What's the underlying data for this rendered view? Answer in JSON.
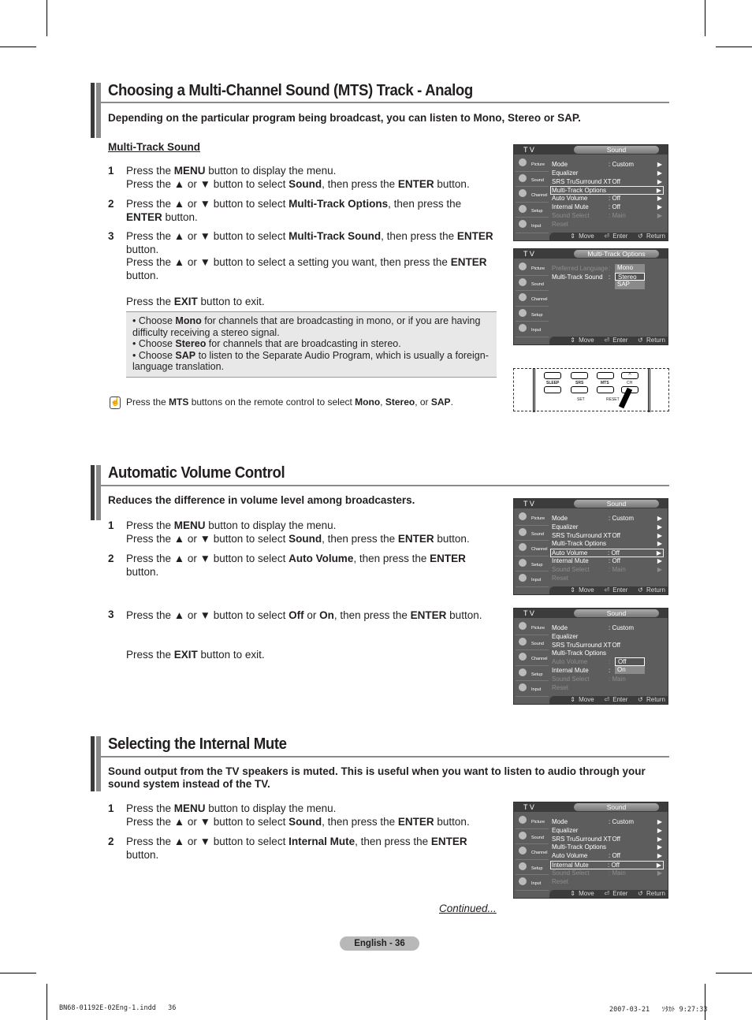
{
  "section1": {
    "title": "Choosing a Multi-Channel Sound (MTS) Track - Analog",
    "lead": "Depending on the particular program being broadcast, you can listen to Mono, Stereo or SAP.",
    "subhead": "Multi-Track Sound",
    "steps": [
      {
        "n": "1",
        "html": "Press the <b>MENU</b> button to display the menu.<br>Press the ▲ or ▼ button to select <b>Sound</b>, then press the <b>ENTER</b> button."
      },
      {
        "n": "2",
        "html": "Press the ▲ or ▼ button to select <b>Multi-Track Options</b>, then press the <b>ENTER</b> button."
      },
      {
        "n": "3",
        "html": "Press the ▲ or ▼ button to select <b>Multi-Track Sound</b>, then press the <b>ENTER</b> button.<br>Press the ▲ or ▼ button to select a setting you want, then press the <b>ENTER</b> button.<br><br>Press the <b>EXIT</b> button to exit."
      }
    ],
    "notes": [
      "• Choose <b>Mono</b> for channels that are broadcasting in mono, or if you are having difficulty receiving a stereo signal.",
      "• Choose <b>Stereo</b> for channels that are broadcasting in stereo.",
      "• Choose <b>SAP</b> to listen to the Separate Audio Program, which is usually a foreign-language translation."
    ],
    "tip": "Press the <b>MTS</b> buttons on the remote control to select <b>Mono</b>, <b>Stereo</b>, or <b>SAP</b>."
  },
  "section2": {
    "title": "Automatic Volume Control",
    "lead": "Reduces the difference in volume level among broadcasters.",
    "steps": [
      {
        "n": "1",
        "html": "Press the <b>MENU</b> button to display the menu.<br>Press the ▲ or ▼ button to select <b>Sound</b>, then press the <b>ENTER</b> button."
      },
      {
        "n": "2",
        "html": "Press the ▲ or ▼ button to select <b>Auto Volume</b>, then press the <b>ENTER</b> button."
      },
      {
        "n": "3",
        "html": "Press the ▲ or ▼ button to select <b>Off</b> or <b>On</b>, then press the <b>ENTER</b> button.<br><br>Press the <b>EXIT</b> button to exit."
      }
    ]
  },
  "section3": {
    "title": "Selecting the Internal Mute",
    "lead": "Sound output from the TV speakers is muted. This is useful when you want to listen to audio through your sound system instead of the TV.",
    "steps": [
      {
        "n": "1",
        "html": "Press the <b>MENU</b> button to display the menu.<br>Press the ▲ or ▼ button to select <b>Sound</b>, then press the <b>ENTER</b> button."
      },
      {
        "n": "2",
        "html": "Press the ▲ or ▼ button to select <b>Internal Mute</b>, then press the <b>ENTER</b> button."
      }
    ],
    "continued": "Continued..."
  },
  "menu_common": {
    "tv": "T V",
    "sidebar": [
      "Picture",
      "Sound",
      "Channel",
      "Setup",
      "Input"
    ],
    "footer": "⇕ Move   ⏎ Enter   ↺ Return"
  },
  "menus": [
    {
      "title": "Sound",
      "rows": [
        [
          "Mode",
          ": Custom",
          "▶",
          ""
        ],
        [
          "Equalizer",
          "",
          "▶",
          ""
        ],
        [
          "SRS TruSurround XT",
          ": Off",
          "▶",
          ""
        ],
        [
          "Multi-Track Options",
          "",
          "▶",
          "sel"
        ],
        [
          "Auto Volume",
          ": Off",
          "▶",
          ""
        ],
        [
          "Internal Mute",
          ": Off",
          "▶",
          ""
        ],
        [
          "Sound Select",
          ": Main",
          "▶",
          "dim"
        ],
        [
          "Reset",
          "",
          "",
          "dim"
        ]
      ]
    },
    {
      "title": "Multi-Track Options",
      "rows": [
        [
          "Preferred Language",
          ":",
          "",
          "dim"
        ],
        [
          "Multi-Track Sound",
          ":",
          "",
          ""
        ]
      ],
      "dropdown": {
        "row": 0,
        "options": [
          "Mono",
          "Stereo",
          "SAP"
        ],
        "selected": 1
      }
    },
    {
      "title": "Sound",
      "rows": [
        [
          "Mode",
          ": Custom",
          "▶",
          ""
        ],
        [
          "Equalizer",
          "",
          "▶",
          ""
        ],
        [
          "SRS TruSurround XT",
          ": Off",
          "▶",
          ""
        ],
        [
          "Multi-Track Options",
          "",
          "▶",
          ""
        ],
        [
          "Auto Volume",
          ": Off",
          "▶",
          "sel"
        ],
        [
          "Internal Mute",
          ": Off",
          "▶",
          ""
        ],
        [
          "Sound Select",
          ": Main",
          "▶",
          "dim"
        ],
        [
          "Reset",
          "",
          "",
          "dim"
        ]
      ]
    },
    {
      "title": "Sound",
      "rows": [
        [
          "Mode",
          ": Custom",
          "",
          ""
        ],
        [
          "Equalizer",
          "",
          "",
          ""
        ],
        [
          "SRS TruSurround XT",
          ": Off",
          "",
          ""
        ],
        [
          "Multi-Track Options",
          "",
          "",
          ""
        ],
        [
          "Auto Volume",
          ":",
          "",
          "dim"
        ],
        [
          "Internal Mute",
          ":",
          "",
          ""
        ],
        [
          "Sound Select",
          ": Main",
          "",
          "dim"
        ],
        [
          "Reset",
          "",
          "",
          "dim"
        ]
      ],
      "dropdown": {
        "row": 4,
        "options": [
          "Off",
          "On"
        ],
        "selected": 0
      }
    },
    {
      "title": "Sound",
      "rows": [
        [
          "Mode",
          ": Custom",
          "▶",
          ""
        ],
        [
          "Equalizer",
          "",
          "▶",
          ""
        ],
        [
          "SRS TruSurround XT",
          ": Off",
          "▶",
          ""
        ],
        [
          "Multi-Track Options",
          "",
          "▶",
          ""
        ],
        [
          "Auto Volume",
          ": Off",
          "▶",
          ""
        ],
        [
          "Internal Mute",
          ": Off",
          "▶",
          "sel"
        ],
        [
          "Sound Select",
          ": Main",
          "▶",
          "dim"
        ],
        [
          "Reset",
          "",
          "",
          "dim"
        ]
      ]
    }
  ],
  "remote": {
    "buttons": [
      "SLEEP",
      "SRS",
      "MTS",
      "CH"
    ],
    "labels": [
      "SET",
      "RESET"
    ]
  },
  "footer": {
    "page": "English - 36",
    "file": "BN68-01192E-02Eng-1.indd   36",
    "date": "2007-03-21   ｿﾀｶﾄ 9:27:33"
  }
}
